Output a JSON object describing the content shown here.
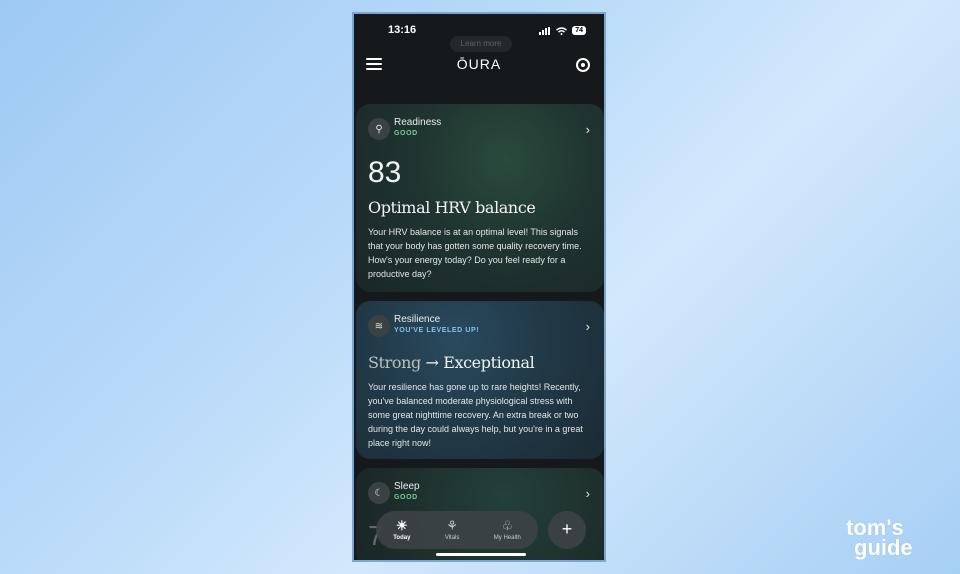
{
  "status": {
    "time": "13:16",
    "battery": "74",
    "learn_more": "Learn more"
  },
  "app": {
    "logo": "ŌURA"
  },
  "readiness": {
    "title": "Readiness",
    "status": "GOOD",
    "status_color": "#6fcf97",
    "score": "83",
    "headline": "Optimal HRV balance",
    "body": "Your HRV balance is at an optimal level! This signals that your body has gotten some quality recovery time. How's your energy today? Do you feel ready for a productive day?"
  },
  "resilience": {
    "title": "Resilience",
    "status": "YOU'VE LEVELED UP!",
    "status_color": "#7fc4ef",
    "headline_from": "Strong",
    "arrow": "→",
    "headline_to": "Exceptional",
    "body": "Your resilience has gone up to rare heights! Recently, you've balanced moderate physiological stress with some great nighttime recovery. An extra break or two during the day could always help, but you're in a great place right now!"
  },
  "sleep": {
    "title": "Sleep",
    "status": "GOOD",
    "status_color": "#6fcf97",
    "score_partial": "7"
  },
  "bottom_nav": {
    "items": [
      {
        "label": "Today",
        "icon": "sun-icon"
      },
      {
        "label": "Vitals",
        "icon": "sprout-icon"
      },
      {
        "label": "My Health",
        "icon": "tree-icon"
      }
    ],
    "plus": "+"
  },
  "watermark": {
    "line1": "tom's",
    "line2": "guide"
  }
}
